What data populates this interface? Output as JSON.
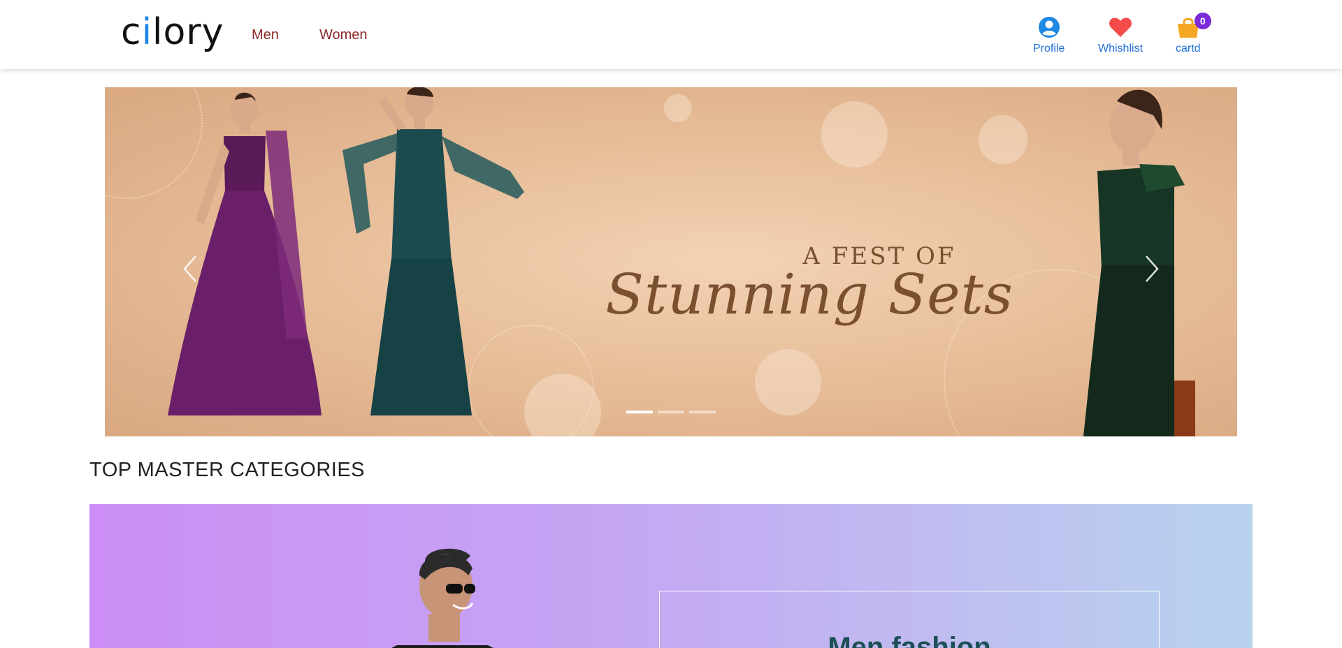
{
  "header": {
    "logo": "cilory",
    "nav": [
      {
        "label": "Men"
      },
      {
        "label": "Women"
      }
    ],
    "profile_label": "Profile",
    "wishlist_label": "Whishlist",
    "cart_label": "cartd",
    "cart_count": "0",
    "icons": {
      "profile": "user-circle-icon",
      "wishlist": "heart-icon",
      "cart": "shopping-bag-icon"
    },
    "colors": {
      "nav_text": "#8b2a2a",
      "action_text": "#1e6fd9",
      "heart": "#f44b4b",
      "cart": "#f5a623",
      "badge": "#7b2ad8"
    }
  },
  "carousel": {
    "headline_top": "A FEST OF",
    "headline_script": "Stunning Sets",
    "slides": 3,
    "active_slide": 1,
    "prev_icon": "chevron-left-icon",
    "next_icon": "chevron-right-icon"
  },
  "section": {
    "title": "TOP MASTER CATEGORIES"
  },
  "master_card": {
    "title": "Men fashion",
    "gradient": [
      "#cc8ef6",
      "#b8d3ee"
    ]
  }
}
